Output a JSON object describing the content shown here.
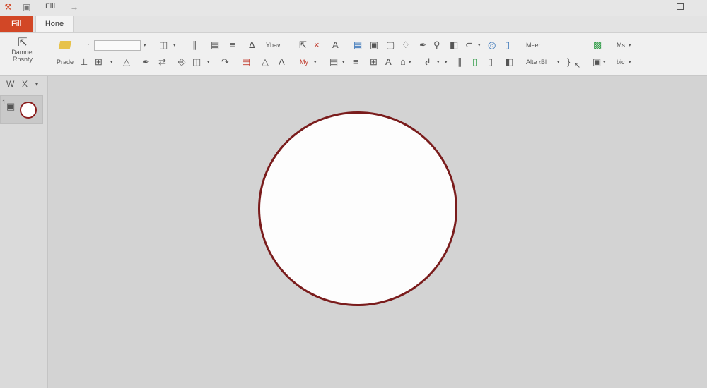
{
  "titlebar": {
    "title": "Fill",
    "arrow": "→"
  },
  "tabs": {
    "file": "Fill",
    "home": "Hone"
  },
  "ribbon": {
    "cursor_button_label_1": "Damnet",
    "cursor_button_label_2": "Rnsnty",
    "paste_label": "Prade",
    "text_labels": {
      "glow": "Ybav",
      "my": "My",
      "meer": "Meer",
      "alte": "Alte ‹Bl",
      "ms": "Ms",
      "bic": "bic"
    }
  },
  "leftpane": {
    "tab_w": "W",
    "tab_x": "X",
    "slide_number": "1"
  },
  "colors": {
    "accent": "#d24726",
    "circle_border": "#7a1c1c",
    "canvas": "#d3d3d3"
  }
}
